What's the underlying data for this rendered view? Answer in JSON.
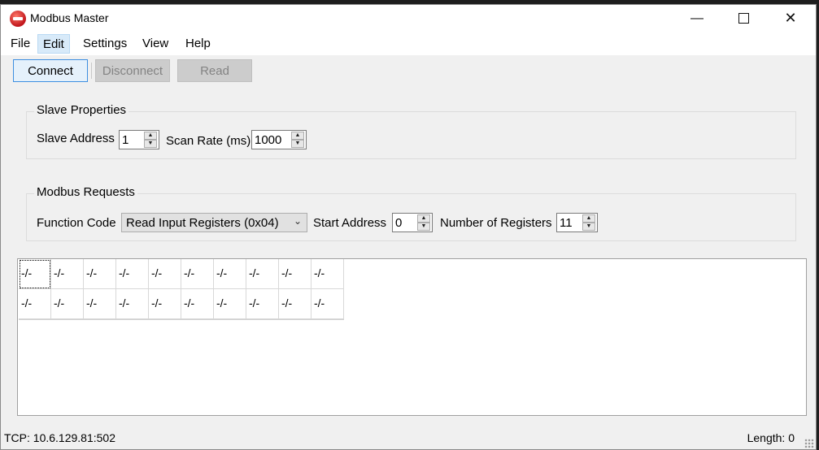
{
  "window": {
    "title": "Modbus Master",
    "icon": "modbus-app-icon"
  },
  "menu": {
    "items": [
      "File",
      "Edit",
      "Settings",
      "View",
      "Help"
    ],
    "active": "Edit"
  },
  "toolbar": {
    "connect": "Connect",
    "disconnect": "Disconnect",
    "read": "Read"
  },
  "slave": {
    "group_title": "Slave Properties",
    "address_label": "Slave Address",
    "address_value": "1",
    "scan_label": "Scan Rate (ms)",
    "scan_value": "1000"
  },
  "requests": {
    "group_title": "Modbus Requests",
    "function_label": "Function Code",
    "function_value": "Read Input Registers (0x04)",
    "start_label": "Start Address",
    "start_value": "0",
    "count_label": "Number of Registers",
    "count_value": "11"
  },
  "grid": {
    "rows": [
      [
        "-/-",
        "-/-",
        "-/-",
        "-/-",
        "-/-",
        "-/-",
        "-/-",
        "-/-",
        "-/-",
        "-/-"
      ],
      [
        "-/-",
        "-/-",
        "-/-",
        "-/-",
        "-/-",
        "-/-",
        "-/-",
        "-/-",
        "-/-",
        "-/-"
      ]
    ]
  },
  "status": {
    "connection": "TCP: 10.6.129.81:502",
    "length": "Length: 0"
  },
  "colors": {
    "accent": "#3d8ee0",
    "menu_active_bg": "#d8eaf9",
    "disabled_bg": "#cccccc"
  }
}
